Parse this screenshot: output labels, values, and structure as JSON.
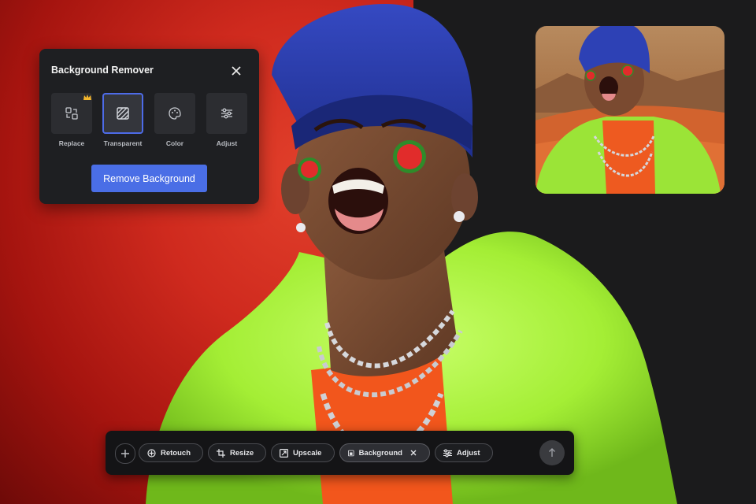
{
  "panel": {
    "title": "Background Remover",
    "tools": [
      {
        "label": "Replace",
        "icon": "replace-icon",
        "premium": true
      },
      {
        "label": "Transparent",
        "icon": "transparent-icon",
        "active": true
      },
      {
        "label": "Color",
        "icon": "palette-icon"
      },
      {
        "label": "Adjust",
        "icon": "sliders-icon"
      }
    ],
    "action_label": "Remove Background"
  },
  "toolbar": {
    "chips": [
      {
        "label": "Retouch",
        "icon": "retouch-icon"
      },
      {
        "label": "Resize",
        "icon": "crop-icon"
      },
      {
        "label": "Upscale",
        "icon": "upscale-icon"
      },
      {
        "label": "Background",
        "icon": "background-icon",
        "active": true
      },
      {
        "label": "Adjust",
        "icon": "sliders-icon"
      }
    ]
  },
  "colors": {
    "accent": "#4a6ee6",
    "red_backdrop": "#d3301f",
    "dark_backdrop": "#1b1b1c",
    "coat": "#a8f23a",
    "cap": "#2a3fae"
  }
}
